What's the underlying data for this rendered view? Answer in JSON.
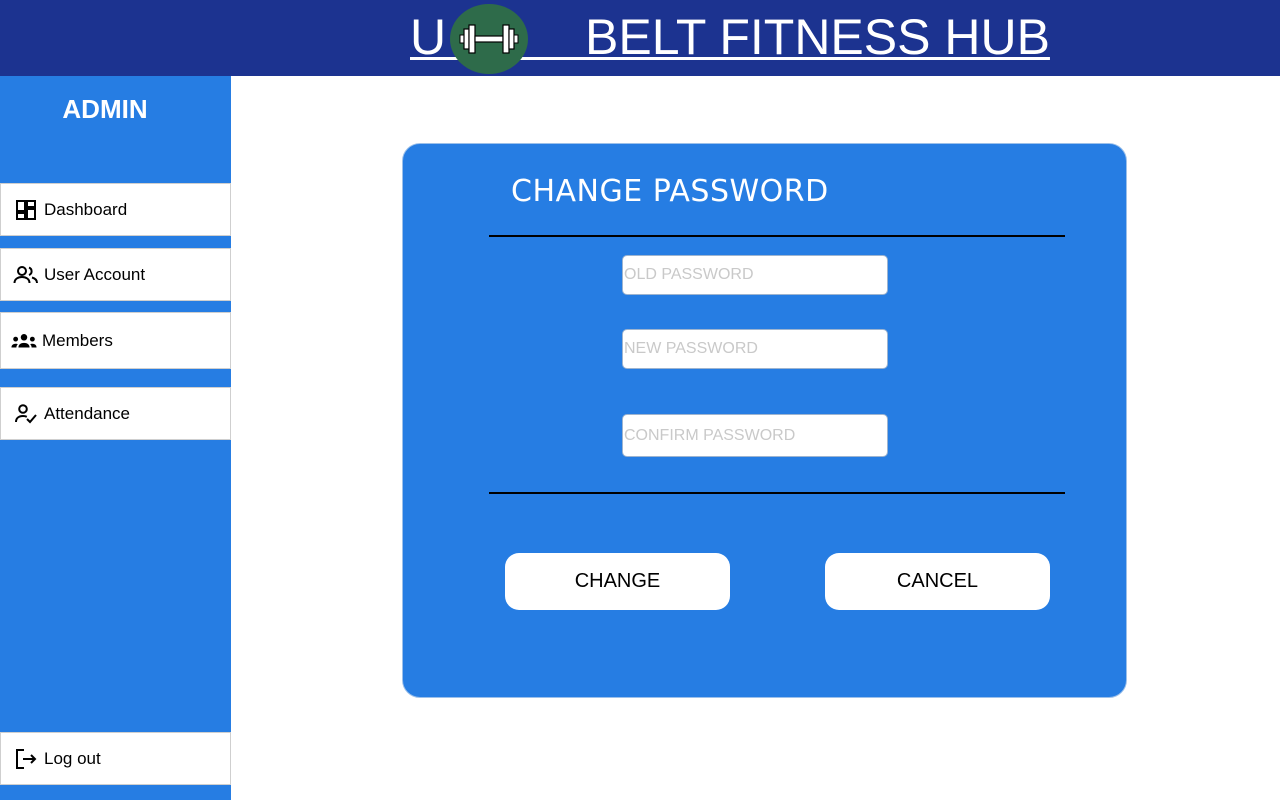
{
  "header": {
    "title": "U          BELT FITNESS HUB",
    "logo_icon": "dumbbell-icon",
    "background": "#1c3390",
    "logo_bg": "#2e6b4a"
  },
  "sidebar": {
    "title": "ADMIN",
    "background": "#267de3",
    "items": [
      {
        "label": "Dashboard",
        "icon": "dashboard-icon"
      },
      {
        "label": "User Account",
        "icon": "user-account-icon"
      },
      {
        "label": "Members",
        "icon": "members-icon"
      },
      {
        "label": "Attendance",
        "icon": "attendance-icon"
      }
    ],
    "logout": {
      "label": "Log out",
      "icon": "logout-icon"
    }
  },
  "form": {
    "title": "CHANGE PASSWORD",
    "old_password": {
      "placeholder": "OLD PASSWORD",
      "value": ""
    },
    "new_password": {
      "placeholder": "NEW PASSWORD",
      "value": ""
    },
    "confirm_password": {
      "placeholder": "CONFIRM PASSWORD",
      "value": ""
    },
    "change_label": "CHANGE",
    "cancel_label": "CANCEL",
    "background": "#267de3"
  }
}
